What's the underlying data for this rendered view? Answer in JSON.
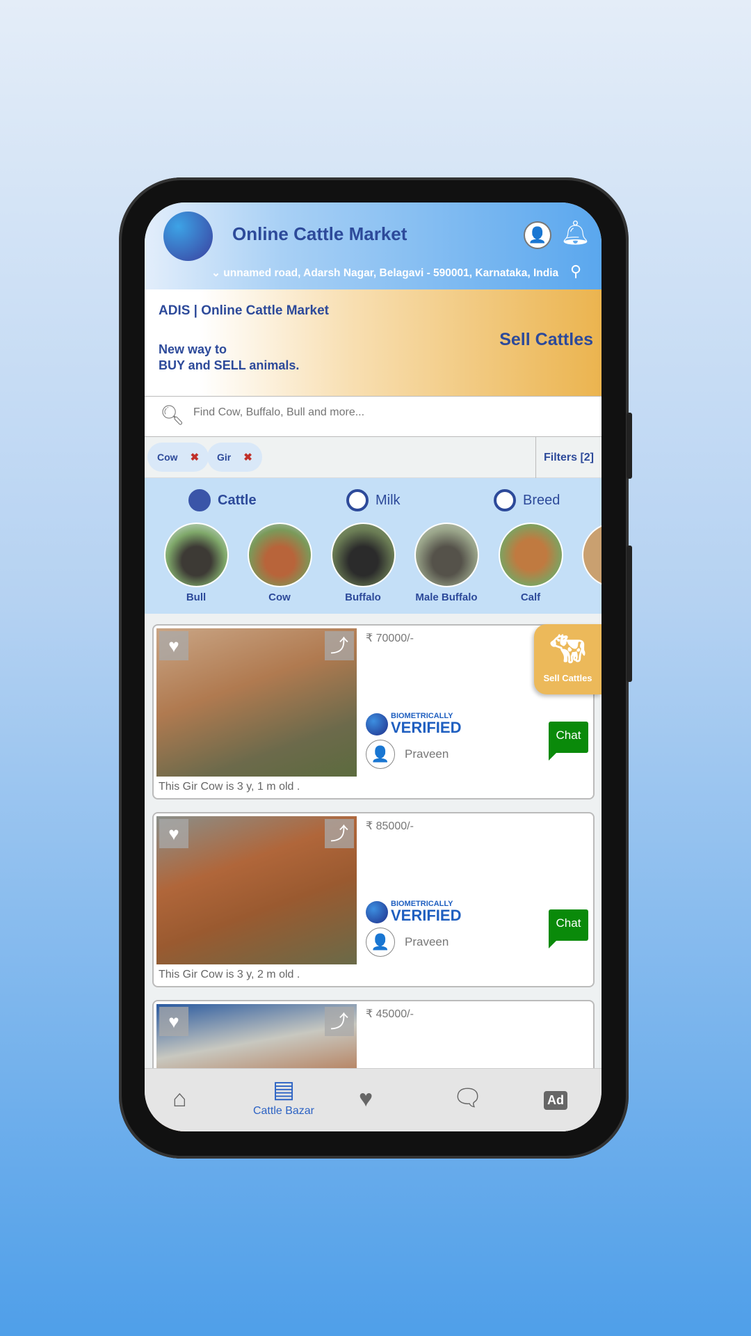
{
  "header": {
    "title": "Online Cattle Market",
    "address": "unnamed road, Adarsh Nagar, Belagavi - 590001, Karnataka, India"
  },
  "banner": {
    "brand": "ADIS | Online Cattle Market",
    "tagline_1": "New way to",
    "tagline_2": "BUY and SELL animals.",
    "cta": "Sell Cattles"
  },
  "search": {
    "placeholder": "Find Cow, Buffalo, Bull and more...",
    "value": ""
  },
  "chips": [
    {
      "label": "Cow"
    },
    {
      "label": "Gir"
    }
  ],
  "filters_label": "Filters [2]",
  "radios": [
    {
      "label": "Cattle",
      "selected": true
    },
    {
      "label": "Milk",
      "selected": false
    },
    {
      "label": "Breed",
      "selected": false
    }
  ],
  "categories": [
    {
      "label": "Bull"
    },
    {
      "label": "Cow"
    },
    {
      "label": "Buffalo"
    },
    {
      "label": "Male Buffalo"
    },
    {
      "label": "Calf"
    }
  ],
  "listings": [
    {
      "price": "₹ 70000/-",
      "badge_small": "BIOMETRICALLY",
      "badge_large": "VERIFIED",
      "seller": "Praveen",
      "chat": "Chat",
      "description": "This Gir Cow  is 3 y, 1 m old ."
    },
    {
      "price": "₹ 85000/-",
      "badge_small": "BIOMETRICALLY",
      "badge_large": "VERIFIED",
      "seller": "Praveen",
      "chat": "Chat",
      "description": "This Gir Cow  is 3 y, 2 m old ."
    },
    {
      "price": "₹ 45000/-"
    }
  ],
  "fab": {
    "label": "Sell Cattles"
  },
  "nav": [
    {
      "icon": "home-icon"
    },
    {
      "icon": "store-icon",
      "label": "Cattle Bazar",
      "active": true
    },
    {
      "icon": "heart-icon"
    },
    {
      "icon": "chat-icon"
    },
    {
      "icon": "ad-icon"
    }
  ],
  "colors": {
    "primary": "#2d4a9a",
    "accent": "#ecb95a",
    "chat": "#0a8a0a",
    "nav_active": "#2d63c4"
  }
}
